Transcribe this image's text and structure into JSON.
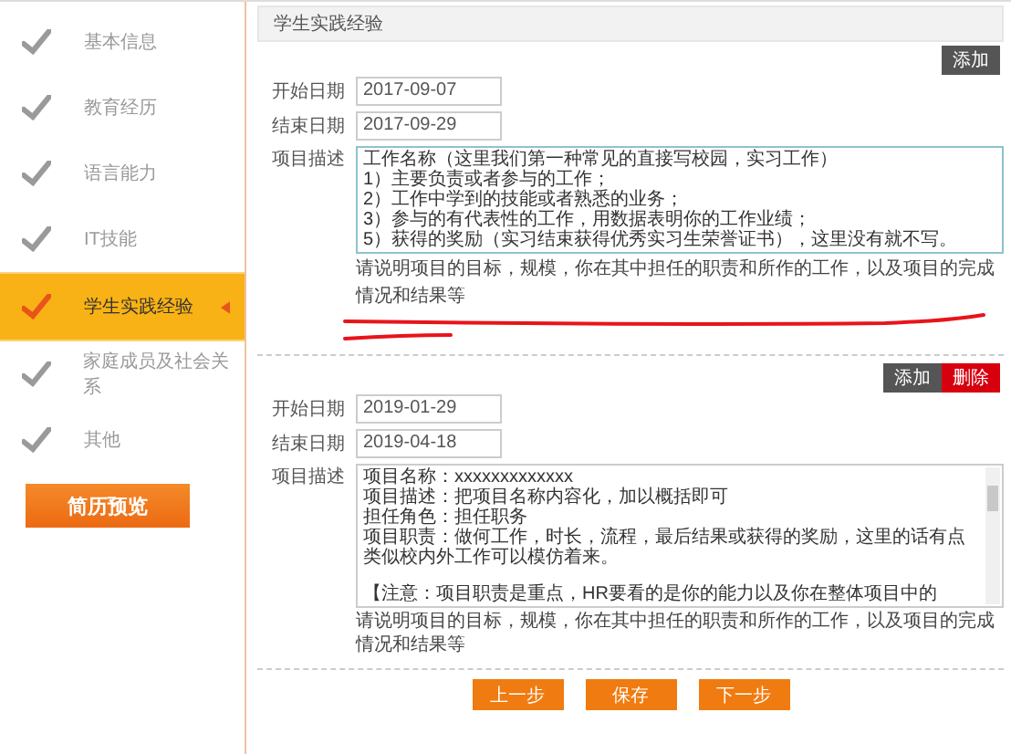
{
  "sidebar": {
    "items": [
      {
        "label": "基本信息",
        "selected": false
      },
      {
        "label": "教育经历",
        "selected": false
      },
      {
        "label": "语言能力",
        "selected": false
      },
      {
        "label": "IT技能",
        "selected": false
      },
      {
        "label": "学生实践经验",
        "selected": true
      },
      {
        "label": "家庭成员及社会关系",
        "selected": false
      },
      {
        "label": "其他",
        "selected": false
      }
    ],
    "preview_button": "简历预览"
  },
  "section": {
    "title": "学生实践经验"
  },
  "entries": [
    {
      "actions": [
        {
          "label": "添加",
          "kind": "add"
        }
      ],
      "start_label": "开始日期",
      "start_date": "2017-09-07",
      "end_label": "结束日期",
      "end_date": "2017-09-29",
      "description_label": "项目描述",
      "description": [
        "工作名称（这里我们第一种常见的直接写校园，实习工作）",
        "1）主要负责或者参与的工作；",
        "2）工作中学到的技能或者熟悉的业务；",
        "3）参与的有代表性的工作，用数据表明你的工作业绩；",
        "5）获得的奖励（实习结束获得优秀实习生荣誉证书），这里没有就不写。"
      ],
      "scrollable": false,
      "hint": "请说明项目的目标，规模，你在其中担任的职责和所作的工作，以及项目的完成情况和结果等",
      "underlined": true
    },
    {
      "actions": [
        {
          "label": "添加",
          "kind": "add"
        },
        {
          "label": "删除",
          "kind": "delete"
        }
      ],
      "start_label": "开始日期",
      "start_date": "2019-01-29",
      "end_label": "结束日期",
      "end_date": "2019-04-18",
      "description_label": "项目描述",
      "description": [
        "项目名称：xxxxxxxxxxxxx",
        "项目描述：把项目名称内容化，加以概括即可",
        "担任角色：担任职务",
        "项目职责：做何工作，时长，流程，最后结果或获得的奖励，这里的话有点类似校内外工作可以模仿着来。"
      ],
      "note": "【注意：项目职责是重点，HR要看的是你的能力以及你在整体项目中的",
      "scrollable": true,
      "hint": "请说明项目的目标，规模，你在其中担任的职责和所作的工作，以及项目的完成情况和结果等",
      "underlined": false
    }
  ],
  "buttons": [
    {
      "label": "上一步"
    },
    {
      "label": "保存"
    },
    {
      "label": "下一步"
    }
  ]
}
